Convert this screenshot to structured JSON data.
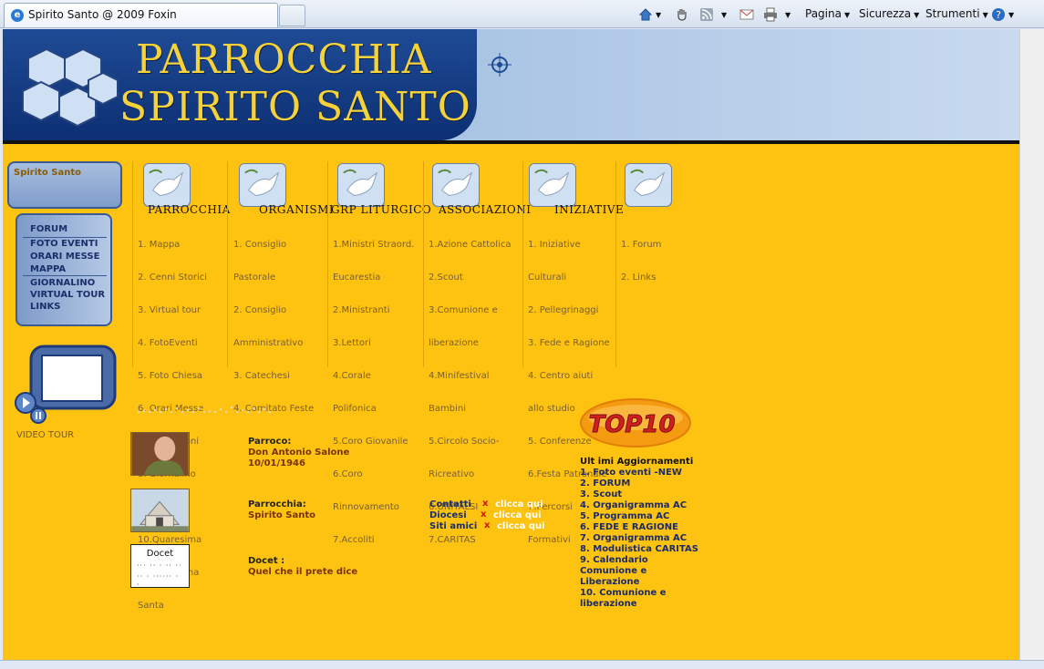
{
  "browser": {
    "tab_title": "Spirito Santo @ 2009 Foxin",
    "commands": {
      "pagina": "Pagina",
      "sicurezza": "Sicurezza",
      "strumenti": "Strumenti"
    }
  },
  "header": {
    "title_line1": "PARROCCHIA",
    "title_line2": "SPIRITO SANTO"
  },
  "sidebar": {
    "tab_label": "Spirito Santo",
    "nav": [
      "FORUM",
      "FOTO EVENTI",
      "ORARI MESSE",
      "MAPPA",
      "GIORNALINO",
      "VIRTUAL TOUR",
      "LINKS"
    ],
    "video_label": "VIDEO TOUR"
  },
  "menus": [
    {
      "title": "PARROCCHIA",
      "items": [
        "1. Mappa",
        "2. Cenni Storici",
        "3. Virtual tour",
        "4. FotoEventi",
        "5. Foto Chiesa",
        "6. Orari Messe",
        "7.Confessioni",
        "8. Giornalino",
        "9.Avvento",
        "10.Quaresima",
        "11.Settimana",
        "Santa"
      ]
    },
    {
      "title": "ORGANISMI",
      "items": [
        "1. Consiglio",
        "Pastorale",
        "2. Consiglio",
        "Amministrativo",
        "3. Catechesi",
        "4. Comitato Feste"
      ]
    },
    {
      "title": "GRP LITURGICO",
      "items": [
        "1.Ministri Straord.",
        "Eucarestia",
        "2.Ministranti",
        "3.Lettori",
        "4.Corale",
        "Polifonica",
        "5.Coro Giovanile",
        "6.Coro",
        "Rinnovamento",
        "7.Accoliti"
      ]
    },
    {
      "title": "ASSOCIAZIONI",
      "items": [
        "1.Azione Cattolica",
        "2.Scout",
        "3.Comunione e",
        "liberazione",
        "4.Minifestival",
        "Bambini",
        "5.Circolo Socio-",
        "Ricreativo",
        "6.UNITALSI",
        "7.CARITAS"
      ]
    },
    {
      "title": "INIZIATIVE",
      "items": [
        "1. Iniziative",
        "Culturali",
        "2. Pellegrinaggi",
        "3. Fede e Ragione",
        "4. Centro aiuti",
        "allo studio",
        "5. Conferenze",
        "6.Festa Patronale",
        "7.Percorsi",
        "Formativi"
      ]
    },
    {
      "title": "",
      "items": [
        "1. Forum",
        "2. Links"
      ]
    }
  ],
  "info": {
    "parroco_label": "Parroco:",
    "parroco_name": "Don Antonio Salone",
    "parroco_date": "10/01/1946",
    "parrocchia_label": "Parrocchia:",
    "parrocchia_name": "Spirito Santo",
    "docet_box_title": "Docet",
    "docet_label": "Docet :",
    "docet_text": "Quel che il prete dice"
  },
  "contacts": [
    {
      "label": "Contatti",
      "link": "clicca qui"
    },
    {
      "label": "Diocesi",
      "link": "clicca qui"
    },
    {
      "label": "Siti amici",
      "link": "clicca qui"
    }
  ],
  "top10": {
    "badge": "TOP10",
    "title": "Ult imi Aggiornamenti",
    "items": [
      "1. Foto eventi -NEW",
      "2. FORUM",
      "3. Scout",
      "4. Organigramma AC",
      "5. Programma AC",
      "6. FEDE E RAGIONE",
      "7. Organigramma AC",
      "8. Modulistica CARITAS",
      "9. Calendario",
      "Comunione e",
      "Liberazione",
      "10. Comunione e",
      "liberazione"
    ]
  },
  "colors": {
    "page_bg": "#fec211",
    "header_blue": "#1e4b95",
    "title_gold": "#f6d23a",
    "link_red": "#d51010"
  }
}
